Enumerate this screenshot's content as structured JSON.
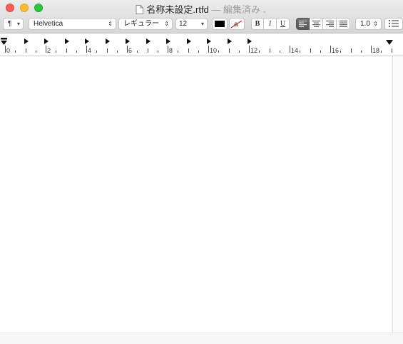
{
  "window": {
    "title": "名称未設定.rtfd",
    "separator": "—",
    "edit_state": "編集済み",
    "controls": {
      "close_color": "#fc5f57",
      "minimize_color": "#fdbc2e",
      "zoom_color": "#28c840"
    }
  },
  "toolbar": {
    "paragraph_style": "¶",
    "font_family": "Helvetica",
    "typeface": "レギュラー",
    "font_size": "12",
    "text_color": "#000000",
    "bold_label": "B",
    "italic_label": "I",
    "underline_label": "U",
    "alignment_selected": "left",
    "line_spacing": "1.0"
  },
  "ruler": {
    "unit": "cm",
    "labels": [
      "0",
      "2",
      "4",
      "6",
      "8",
      "10",
      "12",
      "14",
      "16",
      "18"
    ]
  }
}
